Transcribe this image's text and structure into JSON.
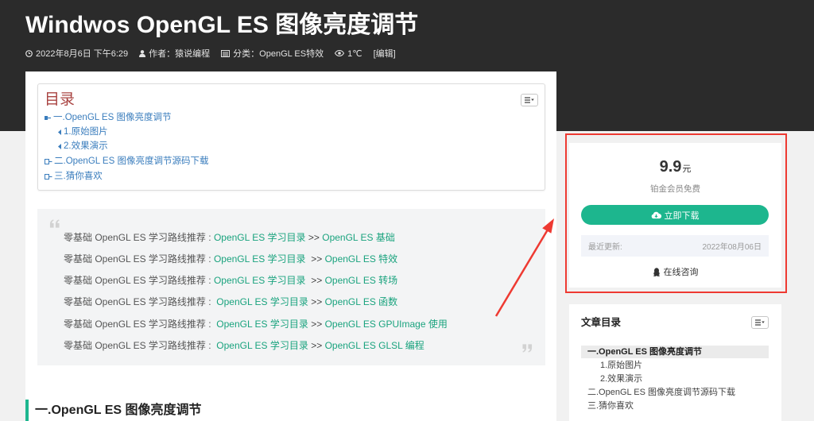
{
  "colors": {
    "header_bg": "#2b2b2b",
    "page_bg": "#f1f1f1",
    "accent": "#1db68e",
    "toc_title": "#a94442",
    "toc_link": "#3a7dbd",
    "quote_link": "#1aa37e",
    "annotation": "#ee3a32"
  },
  "article": {
    "title": "Windwos OpenGL ES 图像亮度调节",
    "meta": {
      "date_icon": "clock-icon",
      "date": "2022年8月6日 下午6:29",
      "author_icon": "user-icon",
      "author": "作者：猿说编程",
      "category_icon": "category-icon",
      "category": "分类：OpenGL ES特效",
      "views_icon": "eye-icon",
      "views": "1℃",
      "edit": "[编辑]"
    },
    "section_heading": "一.OpenGL ES 图像亮度调节"
  },
  "toc": {
    "title": "目录",
    "toggle_icon": "list-toggle-icon",
    "items": [
      {
        "label": "一.OpenGL ES 图像亮度调节",
        "level": 1
      },
      {
        "label": "1.原始图片",
        "level": 2
      },
      {
        "label": "2.效果演示",
        "level": 2
      },
      {
        "label": "二.OpenGL ES 图像亮度调节源码下载",
        "level": 1
      },
      {
        "label": "三.猜你喜欢",
        "level": 1
      }
    ]
  },
  "quote": {
    "open_icon": "quote-open-icon",
    "close_icon": "quote-close-icon",
    "lines": [
      {
        "prefix": "零基础 OpenGL ES 学习路线推荐 : ",
        "link_1": "OpenGL ES 学习目录",
        "separator": " >> ",
        "link_2": "OpenGL ES 基础"
      },
      {
        "prefix": "零基础 OpenGL ES 学习路线推荐 : ",
        "link_1": "OpenGL ES 学习目录",
        "separator": "  >> ",
        "link_2": "OpenGL ES 特效"
      },
      {
        "prefix": "零基础 OpenGL ES 学习路线推荐 : ",
        "link_1": "OpenGL ES 学习目录",
        "separator": "  >> ",
        "link_2": "OpenGL ES 转场"
      },
      {
        "prefix": "零基础 OpenGL ES 学习路线推荐 :  ",
        "link_1": "OpenGL ES 学习目录",
        "separator": " >> ",
        "link_2": "OpenGL ES 函数"
      },
      {
        "prefix": "零基础 OpenGL ES 学习路线推荐 :  ",
        "link_1": "OpenGL ES 学习目录",
        "separator": " >> ",
        "link_2": "OpenGL ES GPUImage 使用"
      },
      {
        "prefix": "零基础 OpenGL ES 学习路线推荐 :  ",
        "link_1": "OpenGL ES 学习目录",
        "separator": " >> ",
        "link_2": "OpenGL ES GLSL 编程"
      }
    ]
  },
  "sidebar": {
    "download": {
      "price": "9.9",
      "currency": "元",
      "note": "铂金会员免费",
      "button_icon": "cloud-download-icon",
      "button": "立即下载",
      "updated_label": "最近更新:",
      "updated_value": "2022年08月06日",
      "consult_icon": "qq-penguin-icon",
      "consult": "在线咨询"
    },
    "article_toc": {
      "title": "文章目录",
      "items": [
        {
          "label": "一.OpenGL ES 图像亮度调节",
          "level": 1,
          "active": true
        },
        {
          "label": "1.原始图片",
          "level": 2
        },
        {
          "label": "2.效果演示",
          "level": 2
        },
        {
          "label": "二.OpenGL ES 图像亮度调节源码下载",
          "level": 1
        },
        {
          "label": "三.猜你喜欢",
          "level": 1
        }
      ]
    }
  }
}
